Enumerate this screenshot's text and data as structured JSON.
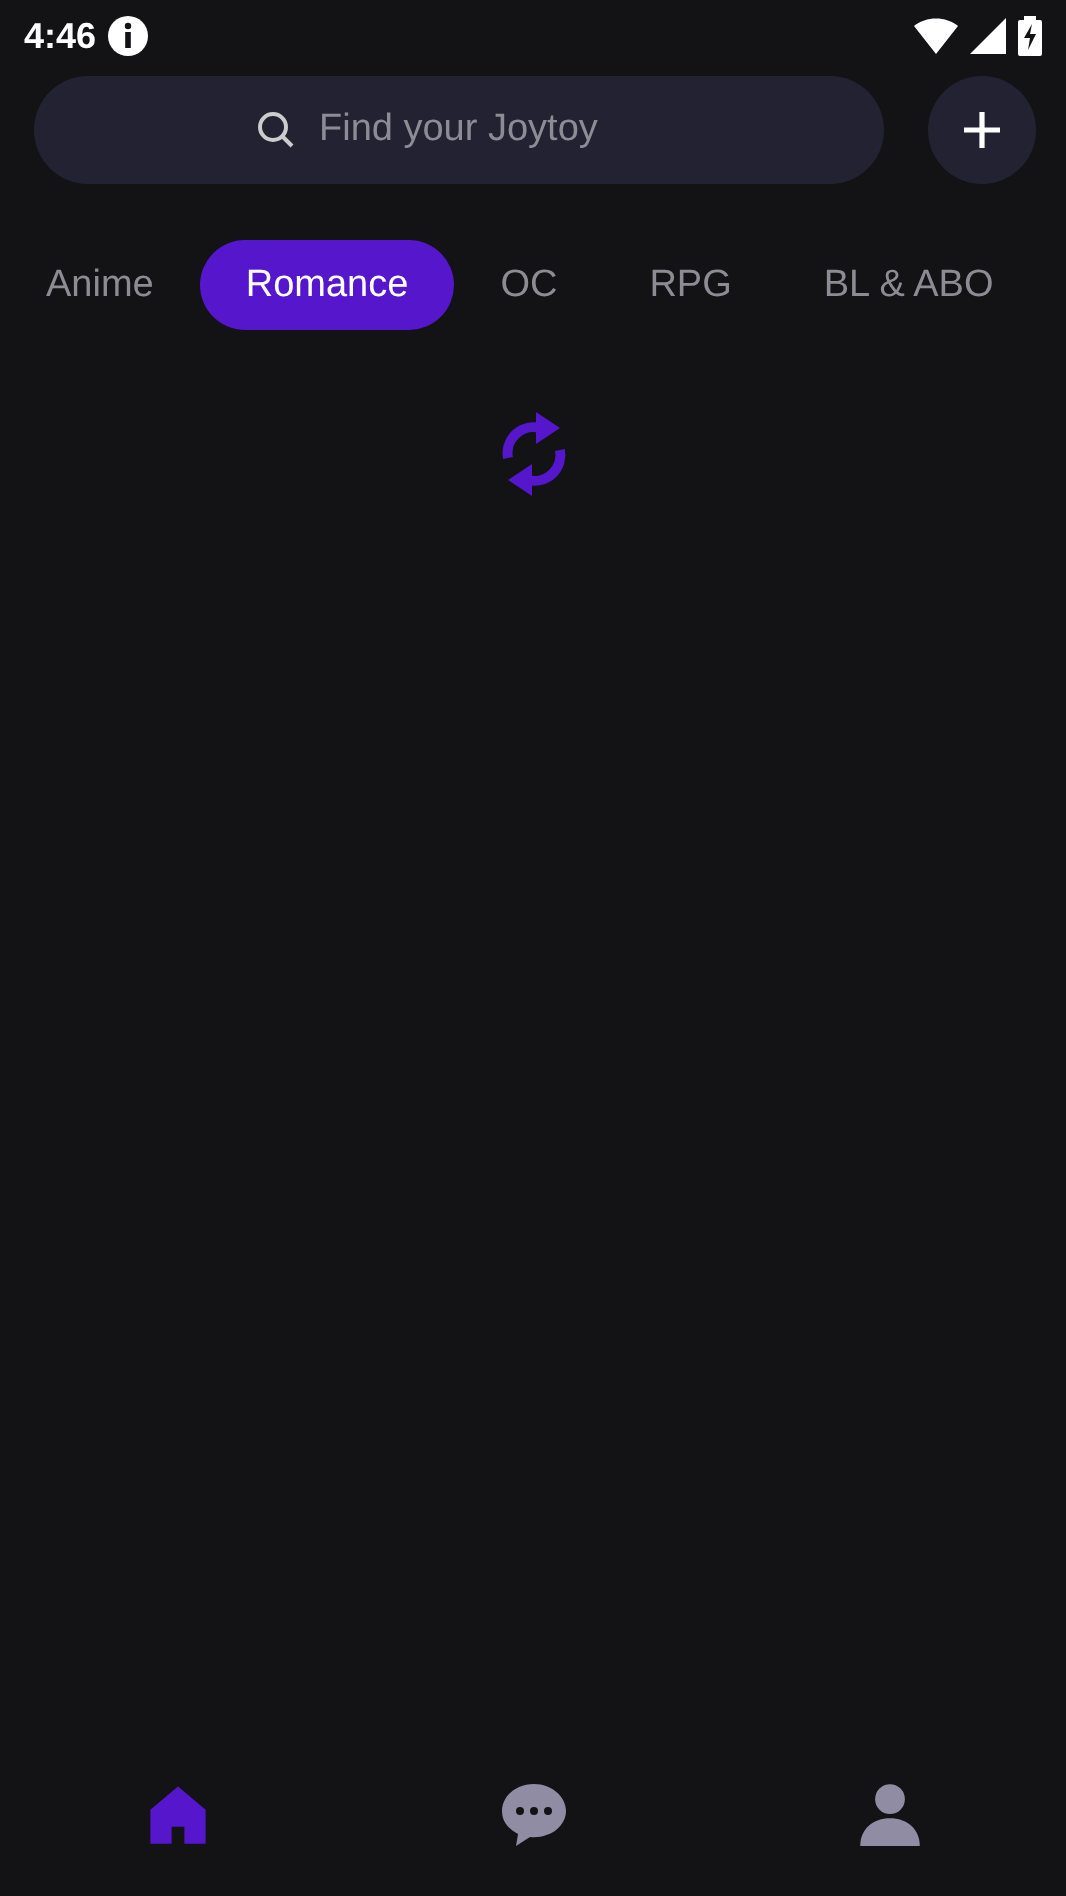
{
  "status_bar": {
    "time": "4:46"
  },
  "search": {
    "placeholder": "Find your Joytoy"
  },
  "categories": [
    {
      "label": "Anime",
      "selected": false
    },
    {
      "label": "Romance",
      "selected": true
    },
    {
      "label": "OC",
      "selected": false
    },
    {
      "label": "RPG",
      "selected": false
    },
    {
      "label": "BL & ABO",
      "selected": false
    }
  ],
  "nav": [
    {
      "kind": "home",
      "selected": true
    },
    {
      "kind": "chat",
      "selected": false
    },
    {
      "kind": "profile",
      "selected": false
    }
  ]
}
